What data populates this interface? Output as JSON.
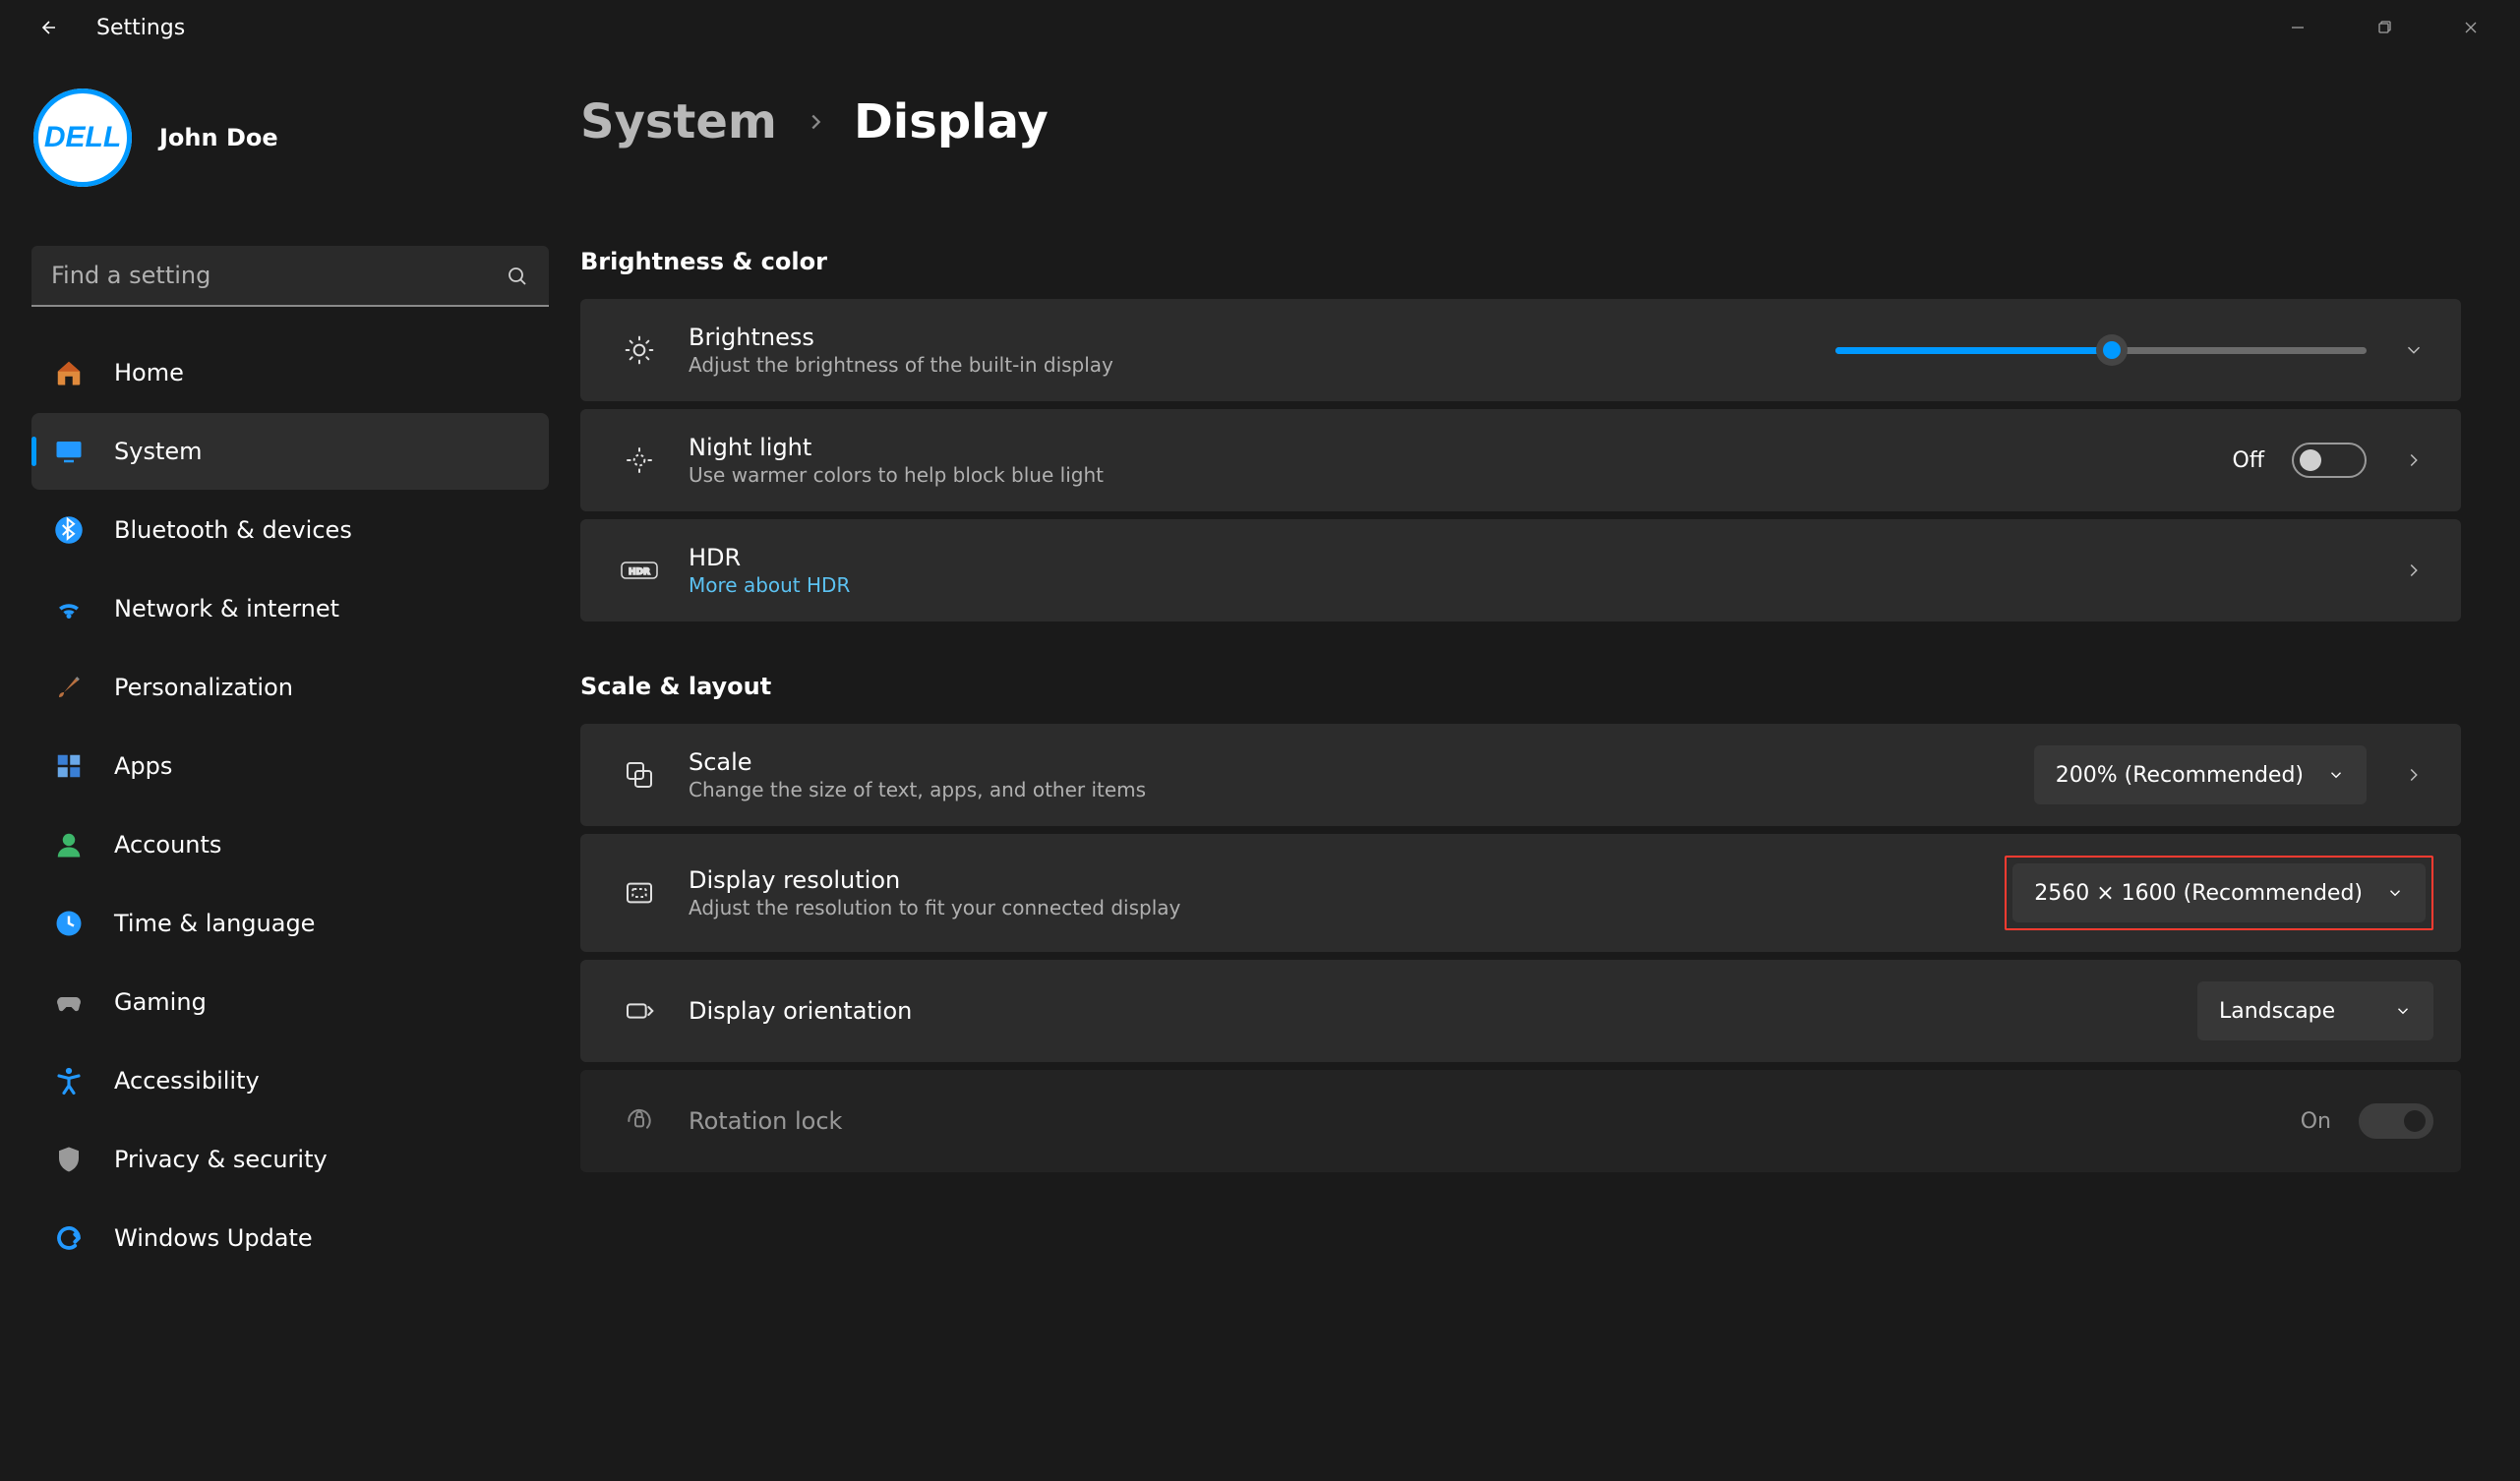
{
  "app_title": "Settings",
  "user": {
    "name": "John Doe",
    "avatar_text": "DELL"
  },
  "search": {
    "placeholder": "Find a setting"
  },
  "nav": [
    {
      "id": "home",
      "label": "Home"
    },
    {
      "id": "system",
      "label": "System",
      "active": true
    },
    {
      "id": "bluetooth",
      "label": "Bluetooth & devices"
    },
    {
      "id": "network",
      "label": "Network & internet"
    },
    {
      "id": "personalization",
      "label": "Personalization"
    },
    {
      "id": "apps",
      "label": "Apps"
    },
    {
      "id": "accounts",
      "label": "Accounts"
    },
    {
      "id": "time",
      "label": "Time & language"
    },
    {
      "id": "gaming",
      "label": "Gaming"
    },
    {
      "id": "accessibility",
      "label": "Accessibility"
    },
    {
      "id": "privacy",
      "label": "Privacy & security"
    },
    {
      "id": "update",
      "label": "Windows Update"
    }
  ],
  "breadcrumb": {
    "parent": "System",
    "current": "Display"
  },
  "sections": {
    "brightness_color": {
      "title": "Brightness & color"
    },
    "scale_layout": {
      "title": "Scale & layout"
    }
  },
  "cards": {
    "brightness": {
      "title": "Brightness",
      "sub": "Adjust the brightness of the built-in display",
      "slider_percent": 52
    },
    "night_light": {
      "title": "Night light",
      "sub": "Use warmer colors to help block blue light",
      "status": "Off"
    },
    "hdr": {
      "title": "HDR",
      "link": "More about HDR"
    },
    "scale": {
      "title": "Scale",
      "sub": "Change the size of text, apps, and other items",
      "value": "200% (Recommended)"
    },
    "resolution": {
      "title": "Display resolution",
      "sub": "Adjust the resolution to fit your connected display",
      "value": "2560 × 1600 (Recommended)"
    },
    "orientation": {
      "title": "Display orientation",
      "value": "Landscape"
    },
    "rotation": {
      "title": "Rotation lock",
      "status": "On"
    }
  },
  "colors": {
    "accent": "#0099ff",
    "highlight": "#ff3b30"
  }
}
